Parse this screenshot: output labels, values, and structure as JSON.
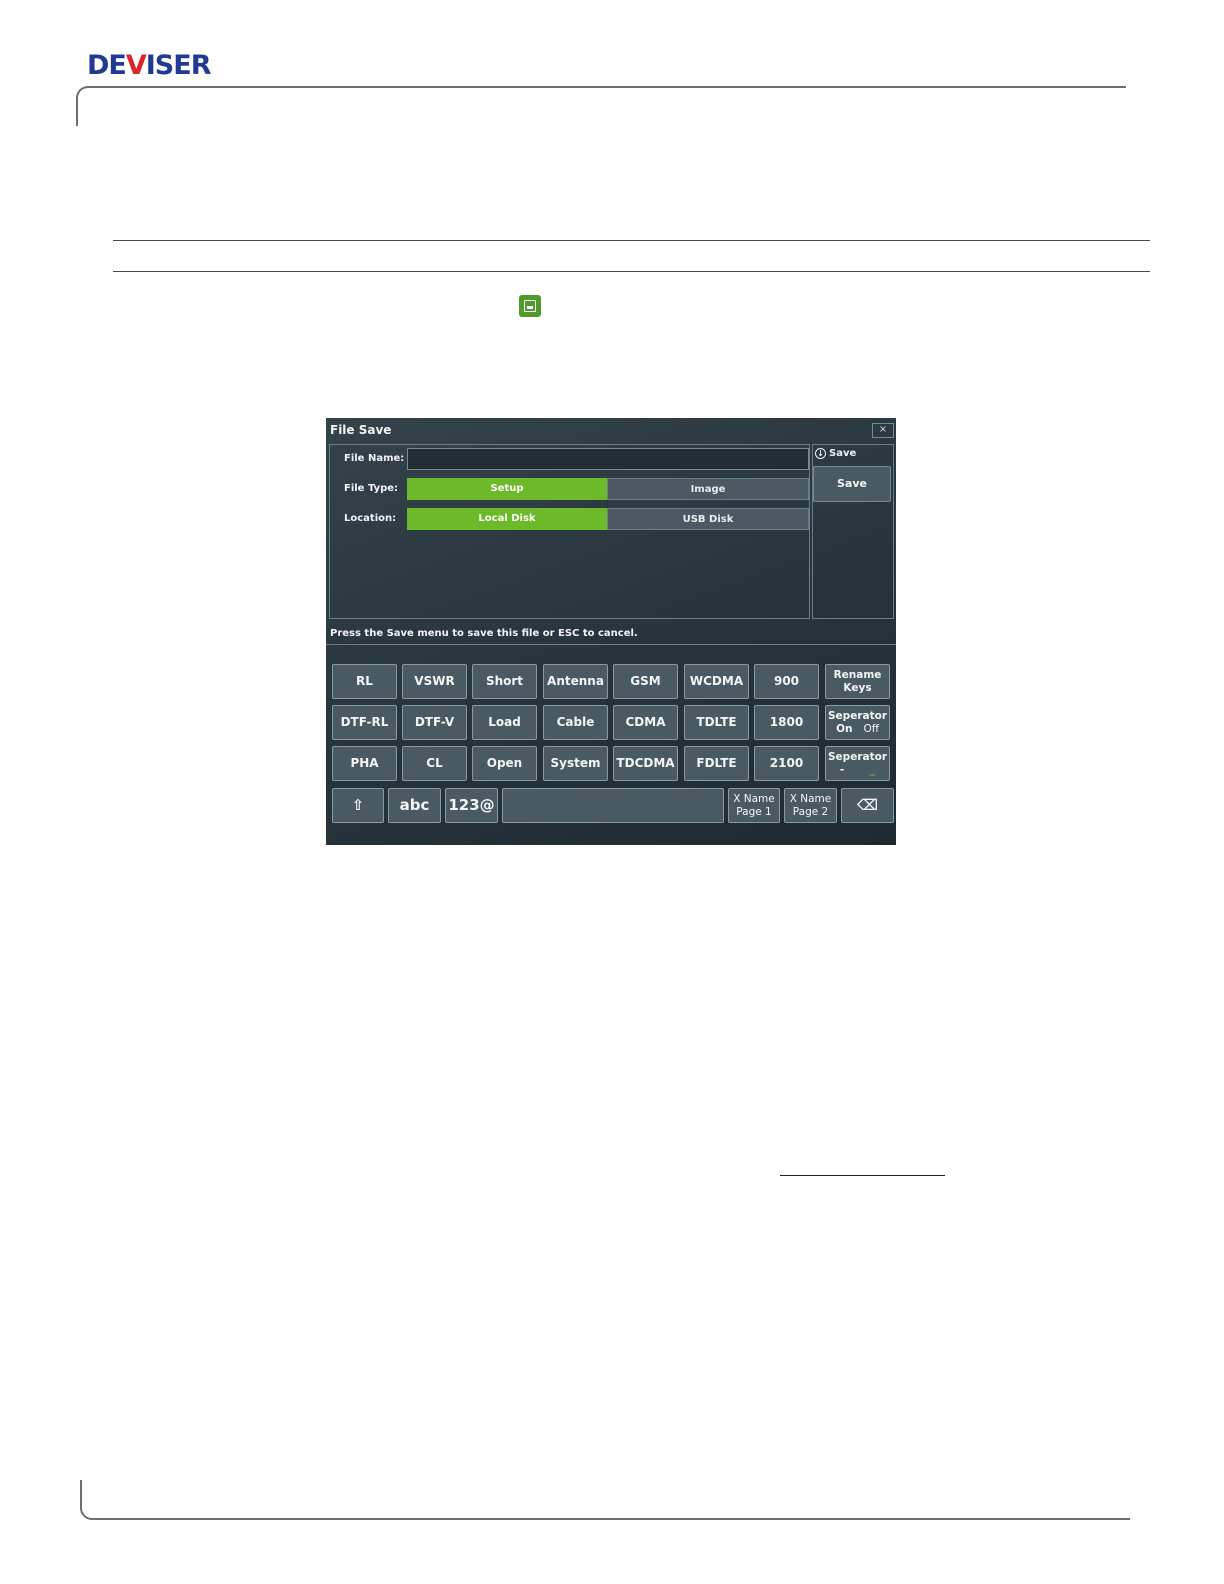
{
  "header": {
    "logo_part1": "DE",
    "logo_part2": "V",
    "logo_part3": "ISER"
  },
  "dialog": {
    "title": "File Save",
    "close_label": "×",
    "fields": {
      "file_name_label": "File Name:",
      "file_name_value": "",
      "file_type_label": "File Type:",
      "file_type_options": [
        "Setup",
        "Image"
      ],
      "file_type_selected": "Setup",
      "location_label": "Location:",
      "location_options": [
        "Local Disk",
        "USB Disk"
      ],
      "location_selected": "Local Disk"
    },
    "side_menu": {
      "header": "Save",
      "save_button": "Save"
    },
    "hint": "Press the Save menu to save this file or ESC to cancel."
  },
  "keyboard": {
    "row1": [
      "RL",
      "VSWR",
      "Short",
      "Antenna",
      "GSM",
      "WCDMA",
      "900"
    ],
    "row1_right": {
      "line1": "Rename",
      "line2": "Keys"
    },
    "row2": [
      "DTF-RL",
      "DTF-V",
      "Load",
      "Cable",
      "CDMA",
      "TDLTE",
      "1800"
    ],
    "row2_right": {
      "line1": "Seperator",
      "on": "On",
      "off": "Off"
    },
    "row3": [
      "PHA",
      "CL",
      "Open",
      "System",
      "TDCDMA",
      "FDLTE",
      "2100"
    ],
    "row3_right": {
      "line1": "Seperator",
      "opt1": "-",
      "opt2": "_"
    },
    "bottom": {
      "abc": "abc",
      "num": "123@",
      "space": "",
      "page1": {
        "line1": "X Name",
        "line2": "Page 1"
      },
      "page2": {
        "line1": "X Name",
        "line2": "Page 2"
      }
    }
  },
  "colors": {
    "accent_green": "#6cb92a",
    "logo_blue": "#1f3a93",
    "logo_red": "#d8262c"
  }
}
